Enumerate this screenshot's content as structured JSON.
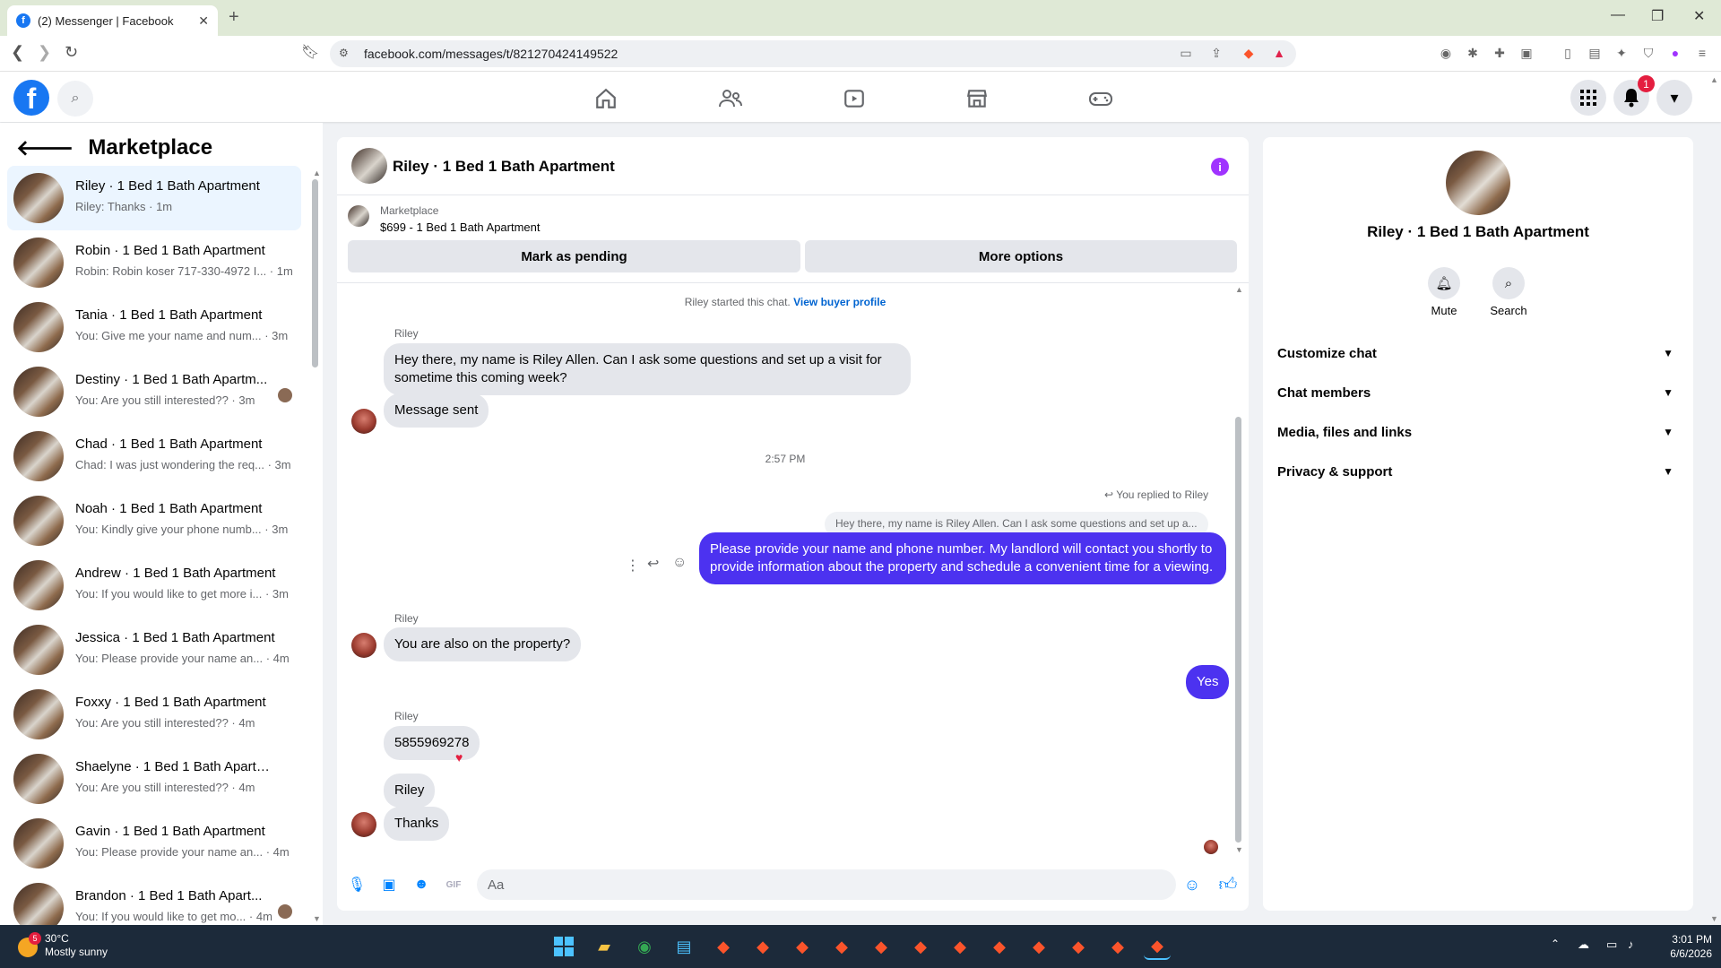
{
  "browser": {
    "tab_title": "(2) Messenger | Facebook",
    "url": "facebook.com/messages/t/821270424149522"
  },
  "header": {
    "notification_count": "1"
  },
  "sidebar": {
    "title": "Marketplace",
    "conversations": [
      {
        "name": "Riley · 1 Bed 1 Bath Apartment",
        "preview": "Riley: Thanks · 1m"
      },
      {
        "name": "Robin · 1 Bed 1 Bath Apartment",
        "preview": "Robin: Robin koser 717-330-4972 I... · 1m"
      },
      {
        "name": "Tania · 1 Bed 1 Bath Apartment",
        "preview": "You: Give me your name and num... · 3m"
      },
      {
        "name": "Destiny · 1 Bed 1 Bath Apartm...",
        "preview": "You: Are you still interested?? · 3m"
      },
      {
        "name": "Chad · 1 Bed 1 Bath Apartment",
        "preview": "Chad: I was just wondering the req... · 3m"
      },
      {
        "name": "Noah · 1 Bed 1 Bath Apartment",
        "preview": "You: Kindly give your phone numb... · 3m"
      },
      {
        "name": "Andrew · 1 Bed 1 Bath Apartment",
        "preview": "You: If you would like to get more i... · 3m"
      },
      {
        "name": "Jessica · 1 Bed 1 Bath Apartment",
        "preview": "You: Please provide your name an... · 4m"
      },
      {
        "name": "Foxxy · 1 Bed 1 Bath Apartment",
        "preview": "You: Are you still interested?? · 4m"
      },
      {
        "name": "Shaelyne · 1 Bed 1 Bath Apartment",
        "preview": "You: Are you still interested?? · 4m"
      },
      {
        "name": "Gavin · 1 Bed 1 Bath Apartment",
        "preview": "You: Please provide your name an... · 4m"
      },
      {
        "name": "Brandon · 1 Bed 1 Bath Apart...",
        "preview": "You: If you would like to get mo... · 4m"
      }
    ]
  },
  "chat": {
    "title": "Riley · 1 Bed 1 Bath Apartment",
    "marketplace_label": "Marketplace",
    "listing": "$699 - 1 Bed 1 Bath Apartment",
    "mark_pending": "Mark as pending",
    "more_options": "More options",
    "started_text": "Riley started this chat.",
    "view_buyer": "View buyer profile",
    "sender_name": "Riley",
    "msg1": "Hey there, my name is Riley Allen. Can I ask some questions and set up a visit for sometime this coming week?",
    "msg2": "Message sent",
    "time": "2:57 PM",
    "replied_label": "You replied to Riley",
    "quoted": "Hey there, my name is Riley Allen. Can I ask some questions and set up a...",
    "out1": "Please provide your name and phone number. My landlord will contact you shortly to provide information about the property and schedule a convenient time for a viewing.",
    "msg3": "You are also on the property?",
    "out2": "Yes",
    "msg4": "5855969278",
    "msg5": "Riley",
    "msg6": "Thanks",
    "composer_placeholder": "Aa"
  },
  "right_panel": {
    "name": "Riley · 1 Bed 1 Bath Apartment",
    "mute": "Mute",
    "search": "Search",
    "sections": [
      "Customize chat",
      "Chat members",
      "Media, files and links",
      "Privacy & support"
    ]
  },
  "taskbar": {
    "temp": "30°C",
    "weather": "Mostly sunny",
    "weather_badge": "5",
    "time": "3:01 PM",
    "date": "6/6/2026"
  },
  "colors": {
    "fb_blue": "#1877f2",
    "outgoing_bubble": "#4c32f0",
    "active_conv": "#ebf5ff"
  }
}
